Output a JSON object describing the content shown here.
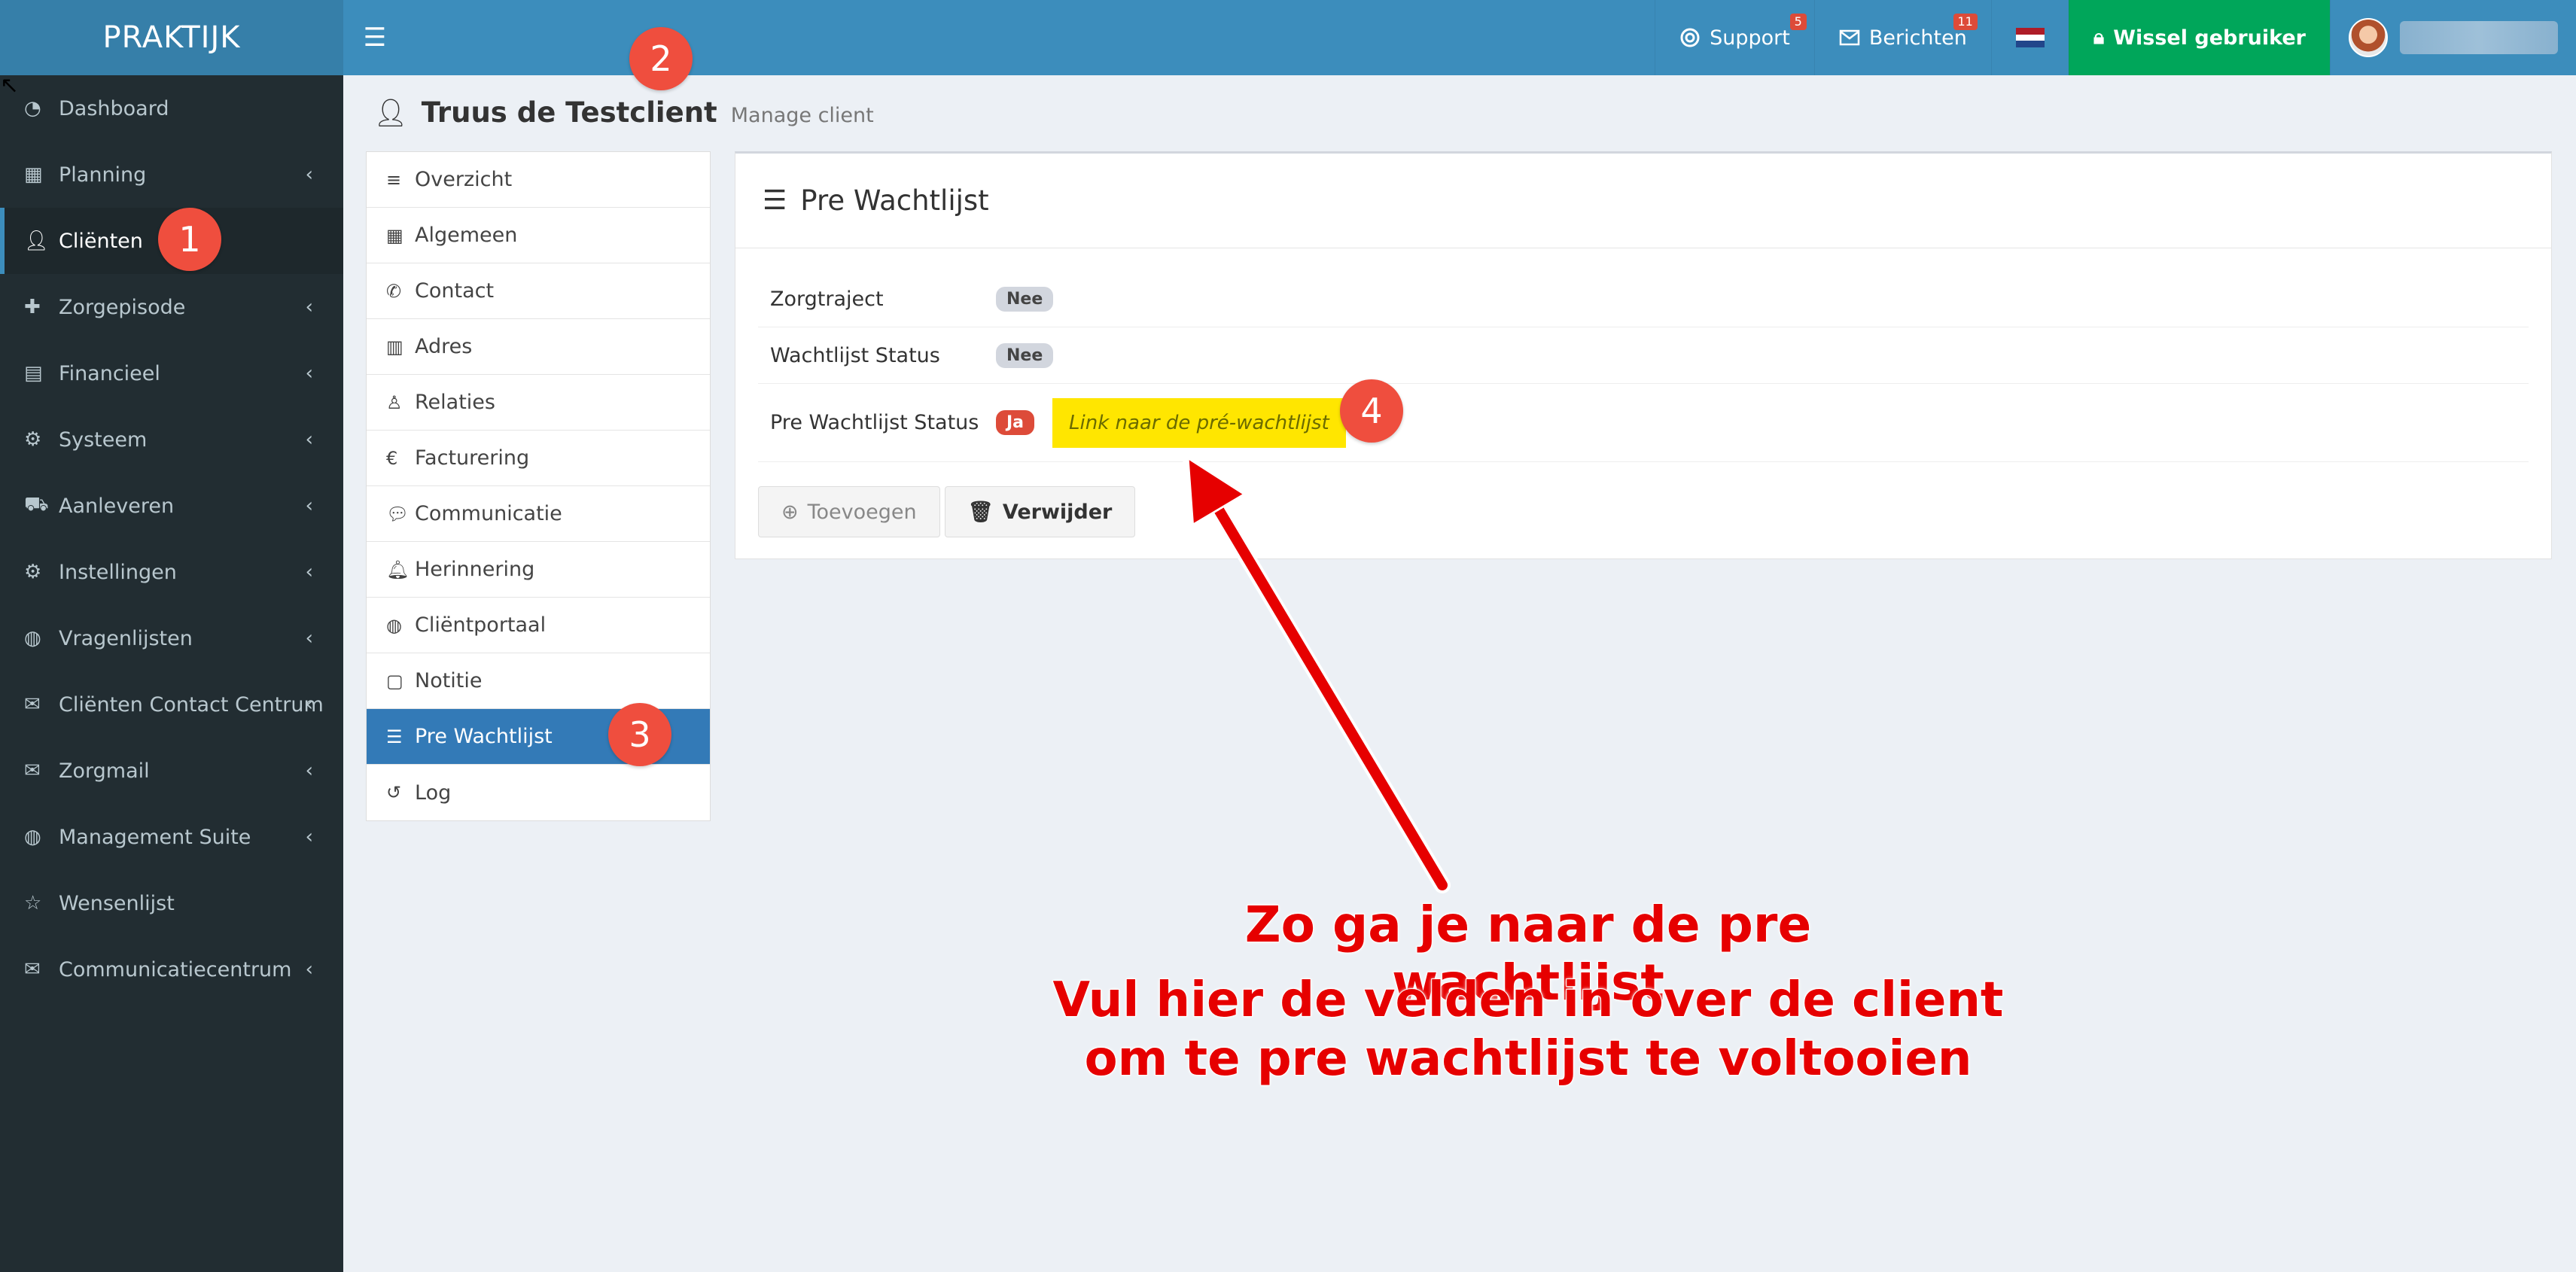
{
  "app": {
    "logo": "PRAKTIJK"
  },
  "topbar": {
    "hamburger_icon": "bars-icon",
    "support": {
      "label": "Support",
      "badge": "5"
    },
    "messages": {
      "label": "Berichten",
      "badge": "11"
    },
    "switch_user": "Wissel gebruiker",
    "flag_colors": [
      "#ae1c28",
      "#ffffff",
      "#21468b"
    ]
  },
  "sidebar": {
    "items": [
      {
        "label": "Dashboard",
        "icon": "dashboard-icon",
        "chevron": false
      },
      {
        "label": "Planning",
        "icon": "calendar-icon",
        "chevron": true
      },
      {
        "label": "Cliënten",
        "icon": "user-icon",
        "chevron": false,
        "active": true
      },
      {
        "label": "Zorgepisode",
        "icon": "medkit-icon",
        "chevron": true
      },
      {
        "label": "Financieel",
        "icon": "book-icon",
        "chevron": true
      },
      {
        "label": "Systeem",
        "icon": "cogs-icon",
        "chevron": true
      },
      {
        "label": "Aanleveren",
        "icon": "truck-icon",
        "chevron": true
      },
      {
        "label": "Instellingen",
        "icon": "cog-icon",
        "chevron": true
      },
      {
        "label": "Vragenlijsten",
        "icon": "globe-icon",
        "chevron": true
      },
      {
        "label": "Cliënten Contact Centrum",
        "icon": "envelope-icon",
        "chevron": true
      },
      {
        "label": "Zorgmail",
        "icon": "envelope-icon",
        "chevron": true
      },
      {
        "label": "Management Suite",
        "icon": "globe-icon",
        "chevron": true
      },
      {
        "label": "Wensenlijst",
        "icon": "star-icon",
        "chevron": false
      },
      {
        "label": "Communicatiecentrum",
        "icon": "envelope-icon",
        "chevron": true
      }
    ]
  },
  "page": {
    "title": "Truus de Testclient",
    "subtitle": "Manage client"
  },
  "client_menu": [
    {
      "label": "Overzicht",
      "icon": "bars-icon"
    },
    {
      "label": "Algemeen",
      "icon": "table-icon"
    },
    {
      "label": "Contact",
      "icon": "phone-icon"
    },
    {
      "label": "Adres",
      "icon": "map-icon"
    },
    {
      "label": "Relaties",
      "icon": "child-icon"
    },
    {
      "label": "Facturering",
      "icon": "euro-icon"
    },
    {
      "label": "Communicatie",
      "icon": "comments-icon"
    },
    {
      "label": "Herinnering",
      "icon": "bell-icon"
    },
    {
      "label": "Cliëntportaal",
      "icon": "globe-icon"
    },
    {
      "label": "Notitie",
      "icon": "file-icon"
    },
    {
      "label": "Pre Wachtlijst",
      "icon": "list-icon",
      "active": true
    },
    {
      "label": "Log",
      "icon": "history-icon"
    }
  ],
  "box": {
    "title": "Pre Wachtlijst",
    "rows": [
      {
        "label": "Zorgtraject",
        "value": "Nee"
      },
      {
        "label": "Wachtlijst Status",
        "value": "Nee"
      },
      {
        "label": "Pre Wachtlijst Status",
        "value": "Ja",
        "link": "Link naar de pré-wachtlijst"
      }
    ],
    "add_button": "Toevoegen",
    "delete_button": "Verwijder"
  },
  "annotations": {
    "markers": [
      "1",
      "2",
      "3",
      "4"
    ],
    "line1": "Zo ga je naar de pre wachtlijst",
    "line2": "Vul hier de velden in over de client",
    "line3": "om te pre wachtlijst te voltooien",
    "color": "#e60000"
  }
}
